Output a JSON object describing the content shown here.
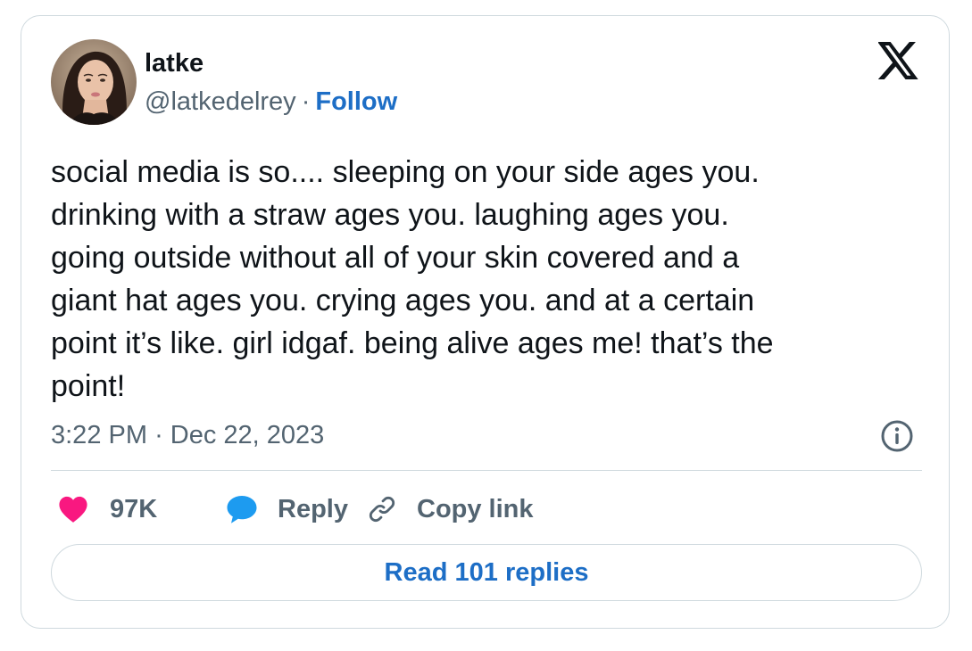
{
  "author": {
    "display_name": "latke",
    "handle": "@latkedelrey",
    "separator": "·",
    "follow_label": "Follow"
  },
  "tweet": {
    "text": "social media is so.... sleeping on your side ages you.\ndrinking with a straw ages you. laughing ages you.\ngoing outside without all of your skin covered and a\ngiant hat ages you. crying ages you. and at a certain\npoint it’s like. girl idgaf. being alive ages me! that’s the\npoint!",
    "time": "3:22 PM",
    "separator": "·",
    "date": "Dec 22, 2023"
  },
  "actions": {
    "like_count": "97K",
    "reply_label": "Reply",
    "copy_link_label": "Copy link"
  },
  "read_replies_label": "Read 101 replies",
  "icons": {
    "logo": "x-logo-icon",
    "info": "info-icon",
    "like": "heart-icon",
    "reply": "speech-bubble-icon",
    "copy": "link-icon"
  },
  "colors": {
    "link_blue": "#1d6ec6",
    "heart_pink": "#f91880",
    "reply_blue": "#1d9bf0",
    "text_dark": "#0f1419",
    "text_gray": "#536471",
    "border": "#cfd9de"
  }
}
